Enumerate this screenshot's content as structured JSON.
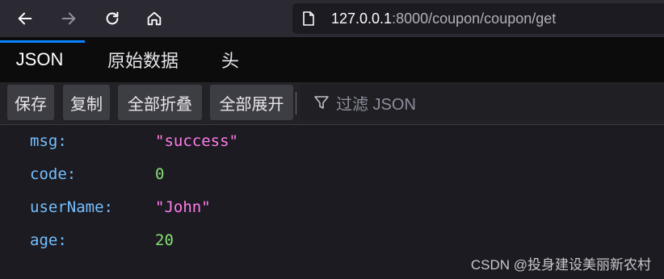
{
  "browser": {
    "url_host": "127.0.0.1",
    "url_rest": ":8000/coupon/coupon/get"
  },
  "tabs": [
    {
      "label": "JSON",
      "active": true
    },
    {
      "label": "原始数据",
      "active": false
    },
    {
      "label": "头",
      "active": false
    }
  ],
  "actions": {
    "save": "保存",
    "copy": "复制",
    "collapse_all": "全部折叠",
    "expand_all": "全部展开",
    "filter_placeholder": "过滤 JSON"
  },
  "json": [
    {
      "key": "msg:",
      "value": "\"success\"",
      "type": "string"
    },
    {
      "key": "code:",
      "value": "0",
      "type": "number"
    },
    {
      "key": "userName:",
      "value": "\"John\"",
      "type": "string"
    },
    {
      "key": "age:",
      "value": "20",
      "type": "number"
    }
  ],
  "watermark": "CSDN @投身建设美丽新农村",
  "colors": {
    "key": "#75bfff",
    "string": "#ff7de9",
    "number": "#86de74",
    "accent": "#0a84ff"
  }
}
